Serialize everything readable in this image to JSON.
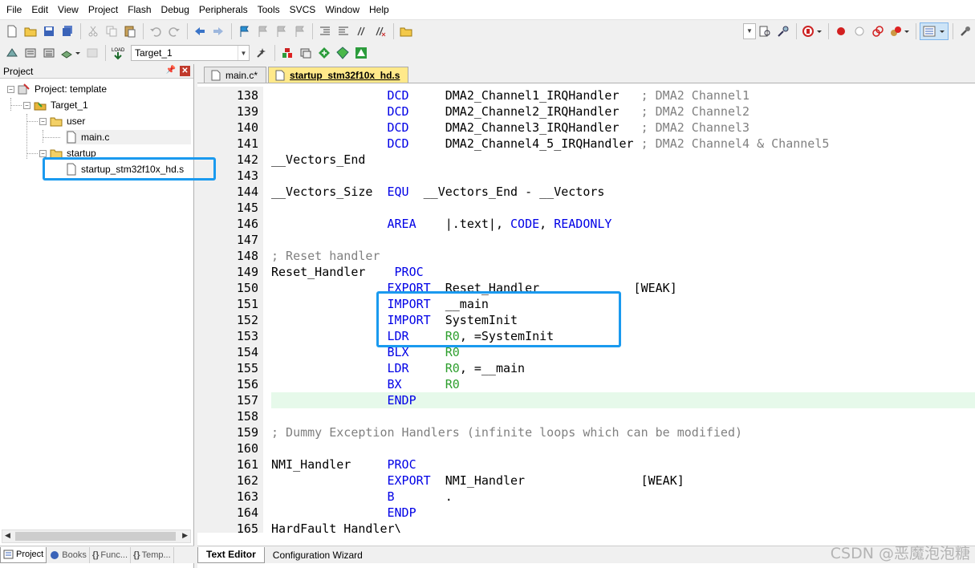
{
  "menu": [
    "File",
    "Edit",
    "View",
    "Project",
    "Flash",
    "Debug",
    "Peripherals",
    "Tools",
    "SVCS",
    "Window",
    "Help"
  ],
  "toolbar2": {
    "target_combo": "Target_1"
  },
  "project_panel": {
    "title": "Project",
    "tree": {
      "root": "Project: template",
      "target": "Target_1",
      "group_user": "user",
      "file_main": "main.c",
      "group_startup": "startup",
      "file_startup": "startup_stm32f10x_hd.s"
    },
    "tabs": [
      "Project",
      "Books",
      "Func...",
      "Temp..."
    ]
  },
  "editor": {
    "tabs": [
      "main.c*",
      "startup_stm32f10x_hd.s"
    ],
    "active_tab": "startup_stm32f10x_hd.s",
    "current_line": 157,
    "lines": [
      {
        "n": "138",
        "parts": [
          {
            "t": "                ",
            "c": ""
          },
          {
            "t": "DCD",
            "c": "kw"
          },
          {
            "t": "     DMA2_Channel1_IRQHandler   ",
            "c": ""
          },
          {
            "t": "; DMA2 Channel1",
            "c": "cm"
          }
        ]
      },
      {
        "n": "139",
        "parts": [
          {
            "t": "                ",
            "c": ""
          },
          {
            "t": "DCD",
            "c": "kw"
          },
          {
            "t": "     DMA2_Channel2_IRQHandler   ",
            "c": ""
          },
          {
            "t": "; DMA2 Channel2",
            "c": "cm"
          }
        ]
      },
      {
        "n": "140",
        "parts": [
          {
            "t": "                ",
            "c": ""
          },
          {
            "t": "DCD",
            "c": "kw"
          },
          {
            "t": "     DMA2_Channel3_IRQHandler   ",
            "c": ""
          },
          {
            "t": "; DMA2 Channel3",
            "c": "cm"
          }
        ]
      },
      {
        "n": "141",
        "parts": [
          {
            "t": "                ",
            "c": ""
          },
          {
            "t": "DCD",
            "c": "kw"
          },
          {
            "t": "     DMA2_Channel4_5_IRQHandler ",
            "c": ""
          },
          {
            "t": "; DMA2 Channel4 & Channel5",
            "c": "cm"
          }
        ]
      },
      {
        "n": "142",
        "parts": [
          {
            "t": "__Vectors_End",
            "c": ""
          }
        ]
      },
      {
        "n": "143",
        "parts": []
      },
      {
        "n": "144",
        "parts": [
          {
            "t": "__Vectors_Size  ",
            "c": ""
          },
          {
            "t": "EQU",
            "c": "kw"
          },
          {
            "t": "  __Vectors_End - __Vectors",
            "c": ""
          }
        ]
      },
      {
        "n": "145",
        "parts": []
      },
      {
        "n": "146",
        "parts": [
          {
            "t": "                ",
            "c": ""
          },
          {
            "t": "AREA",
            "c": "kw"
          },
          {
            "t": "    |.text|, ",
            "c": ""
          },
          {
            "t": "CODE",
            "c": "kw"
          },
          {
            "t": ", ",
            "c": ""
          },
          {
            "t": "READONLY",
            "c": "kw"
          }
        ]
      },
      {
        "n": "147",
        "parts": []
      },
      {
        "n": "148",
        "parts": [
          {
            "t": "; Reset handler",
            "c": "cm"
          }
        ]
      },
      {
        "n": "149",
        "parts": [
          {
            "t": "Reset_Handler    ",
            "c": ""
          },
          {
            "t": "PROC",
            "c": "kw"
          }
        ]
      },
      {
        "n": "150",
        "parts": [
          {
            "t": "                ",
            "c": ""
          },
          {
            "t": "EXPORT",
            "c": "kw"
          },
          {
            "t": "  Reset_Handler             [WEAK]",
            "c": ""
          }
        ]
      },
      {
        "n": "151",
        "parts": [
          {
            "t": "                ",
            "c": ""
          },
          {
            "t": "IMPORT",
            "c": "kw"
          },
          {
            "t": "  __main",
            "c": ""
          }
        ]
      },
      {
        "n": "152",
        "parts": [
          {
            "t": "                ",
            "c": ""
          },
          {
            "t": "IMPORT",
            "c": "kw"
          },
          {
            "t": "  SystemInit",
            "c": ""
          }
        ]
      },
      {
        "n": "153",
        "parts": [
          {
            "t": "                ",
            "c": ""
          },
          {
            "t": "LDR",
            "c": "kw"
          },
          {
            "t": "     ",
            "c": ""
          },
          {
            "t": "R0",
            "c": "num"
          },
          {
            "t": ", =SystemInit",
            "c": ""
          }
        ]
      },
      {
        "n": "154",
        "parts": [
          {
            "t": "                ",
            "c": ""
          },
          {
            "t": "BLX",
            "c": "kw"
          },
          {
            "t": "     ",
            "c": ""
          },
          {
            "t": "R0",
            "c": "num"
          }
        ]
      },
      {
        "n": "155",
        "parts": [
          {
            "t": "                ",
            "c": ""
          },
          {
            "t": "LDR",
            "c": "kw"
          },
          {
            "t": "     ",
            "c": ""
          },
          {
            "t": "R0",
            "c": "num"
          },
          {
            "t": ", =__main",
            "c": ""
          }
        ]
      },
      {
        "n": "156",
        "parts": [
          {
            "t": "                ",
            "c": ""
          },
          {
            "t": "BX",
            "c": "kw"
          },
          {
            "t": "      ",
            "c": ""
          },
          {
            "t": "R0",
            "c": "num"
          }
        ]
      },
      {
        "n": "157",
        "parts": [
          {
            "t": "                ",
            "c": ""
          },
          {
            "t": "ENDP",
            "c": "kw"
          }
        ]
      },
      {
        "n": "158",
        "parts": []
      },
      {
        "n": "159",
        "parts": [
          {
            "t": "; Dummy Exception Handlers (infinite loops which can be modified)",
            "c": "cm"
          }
        ]
      },
      {
        "n": "160",
        "parts": []
      },
      {
        "n": "161",
        "parts": [
          {
            "t": "NMI_Handler     ",
            "c": ""
          },
          {
            "t": "PROC",
            "c": "kw"
          }
        ]
      },
      {
        "n": "162",
        "parts": [
          {
            "t": "                ",
            "c": ""
          },
          {
            "t": "EXPORT",
            "c": "kw"
          },
          {
            "t": "  NMI_Handler                [WEAK]",
            "c": ""
          }
        ]
      },
      {
        "n": "163",
        "parts": [
          {
            "t": "                ",
            "c": ""
          },
          {
            "t": "B",
            "c": "kw"
          },
          {
            "t": "       .",
            "c": ""
          }
        ]
      },
      {
        "n": "164",
        "parts": [
          {
            "t": "                ",
            "c": ""
          },
          {
            "t": "ENDP",
            "c": "kw"
          }
        ]
      },
      {
        "n": "165",
        "parts": [
          {
            "t": "HardFault_Handler\\",
            "c": ""
          }
        ]
      }
    ],
    "bottom_tabs": [
      "Text Editor",
      "Configuration Wizard"
    ]
  },
  "colors": {
    "callout": "#1a9aef",
    "keyword": "#0000e6",
    "comment": "#808080",
    "register": "#2e9f2e",
    "current_line": "#e6f9ea",
    "active_tab": "#ffe98a"
  },
  "watermark": "CSDN @恶魔泡泡糖"
}
